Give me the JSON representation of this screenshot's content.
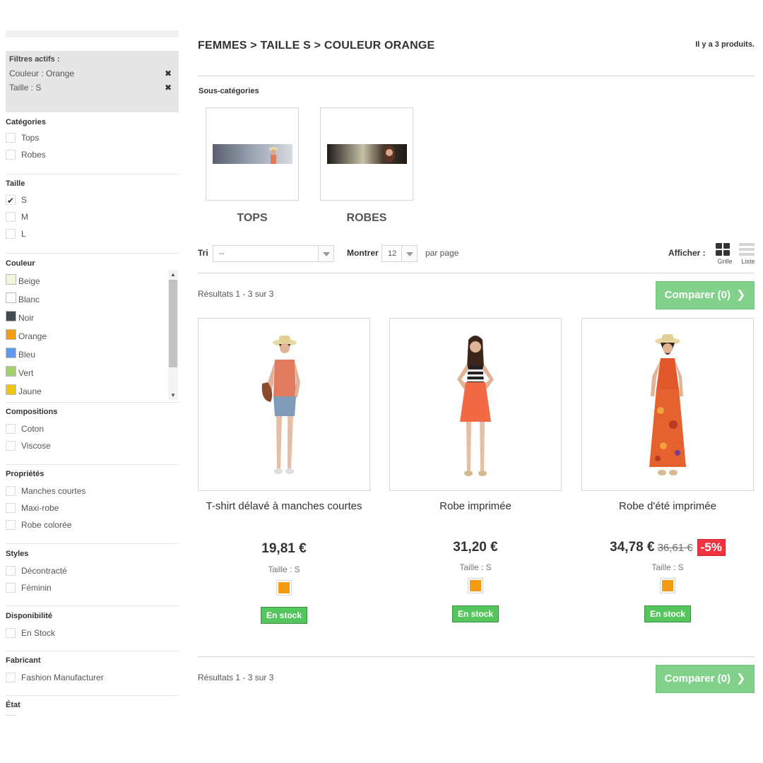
{
  "active_filters": {
    "title": "Filtres actifs :",
    "items": [
      {
        "label": "Couleur : Orange",
        "remove": "✖"
      },
      {
        "label": "Taille : S",
        "remove": "✖"
      }
    ]
  },
  "filters": {
    "categories": {
      "title": "Catégories",
      "items": [
        "Tops",
        "Robes"
      ]
    },
    "size": {
      "title": "Taille",
      "items": [
        {
          "label": "S",
          "checked": true
        },
        {
          "label": "M",
          "checked": false
        },
        {
          "label": "L",
          "checked": false
        }
      ]
    },
    "color": {
      "title": "Couleur",
      "items": [
        {
          "label": "Beige",
          "color": "#f5f5dc"
        },
        {
          "label": "Blanc",
          "color": "#ffffff"
        },
        {
          "label": "Noir",
          "color": "#434a54"
        },
        {
          "label": "Orange",
          "color": "#f39c11"
        },
        {
          "label": "Bleu",
          "color": "#5d9cec"
        },
        {
          "label": "Vert",
          "color": "#a0d468"
        },
        {
          "label": "Jaune",
          "color": "#f1c40f"
        }
      ]
    },
    "compositions": {
      "title": "Compositions",
      "items": [
        "Coton",
        "Viscose"
      ]
    },
    "properties": {
      "title": "Propriétés",
      "items": [
        "Manches courtes",
        "Maxi-robe",
        "Robe colorée"
      ]
    },
    "styles": {
      "title": "Styles",
      "items": [
        "Décontracté",
        "Féminin"
      ]
    },
    "availability": {
      "title": "Disponibilité",
      "items": [
        "En Stock"
      ]
    },
    "manufacturer": {
      "title": "Fabricant",
      "items": [
        "Fashion Manufacturer"
      ]
    },
    "condition": {
      "title": "État"
    }
  },
  "header": {
    "title": "FEMMES > TAILLE S > COULEUR ORANGE",
    "product_count": "Il y a 3 produits."
  },
  "subcategories": {
    "heading": "Sous-catégories",
    "items": [
      {
        "name": "TOPS"
      },
      {
        "name": "ROBES"
      }
    ]
  },
  "toolbar": {
    "sort_label": "Tri",
    "sort_value": "--",
    "show_label": "Montrer",
    "show_value": "12",
    "per_page": "par page",
    "view_label": "Afficher :",
    "grid_label": "Grille",
    "list_label": "Liste"
  },
  "results": {
    "text": "Résultats 1 - 3 sur 3",
    "compare_label": "Comparer (0)",
    "compare_icon": "chevron-right-icon"
  },
  "products": [
    {
      "name": "T-shirt délavé à manches courtes",
      "price": "19,81 €",
      "old_price": "",
      "discount": "",
      "size": "Taille : S",
      "swatch": "#f39c11",
      "stock": "En stock"
    },
    {
      "name": "Robe imprimée",
      "price": "31,20 €",
      "old_price": "",
      "discount": "",
      "size": "Taille : S",
      "swatch": "#f39c11",
      "stock": "En stock"
    },
    {
      "name": "Robe d'été imprimée",
      "price": "34,78 €",
      "old_price": "36,61 €",
      "discount": "-5%",
      "size": "Taille : S",
      "swatch": "#f39c11",
      "stock": "En stock"
    }
  ]
}
